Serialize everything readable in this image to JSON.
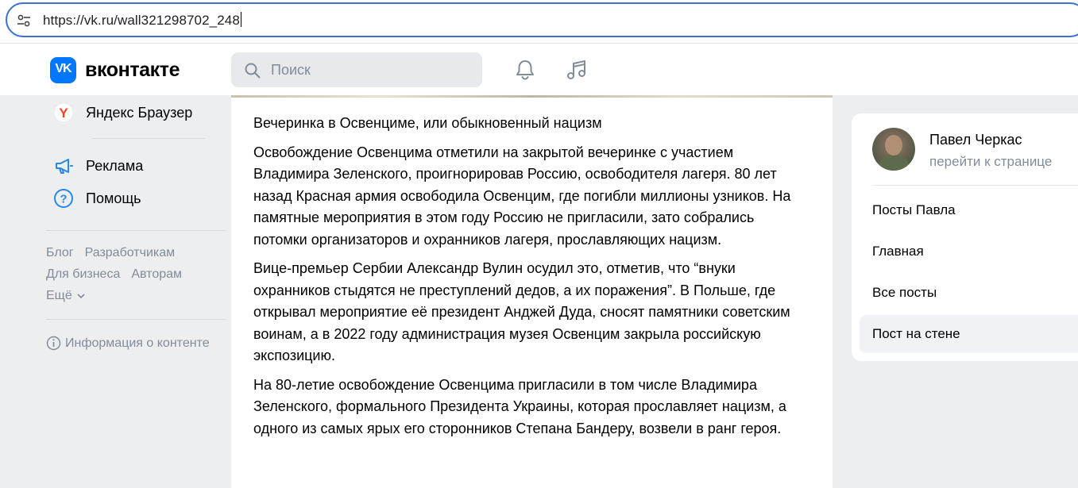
{
  "browser": {
    "url": "https://vk.ru/wall321298702_248"
  },
  "header": {
    "logo_text": "вконтакте",
    "logo_mark": "VK",
    "search_placeholder": "Поиск",
    "icons": [
      "bell-icon",
      "music-icon"
    ]
  },
  "sidebar": {
    "items": [
      {
        "label": "Яндекс Браузер",
        "icon": "yandex-browser-icon"
      },
      {
        "label": "Реклама",
        "icon": "megaphone-icon"
      },
      {
        "label": "Помощь",
        "icon": "help-icon"
      }
    ],
    "footer_links": [
      "Блог",
      "Разработчикам",
      "Для бизнеса",
      "Авторам",
      "Ещё"
    ],
    "content_info": "Информация о контенте"
  },
  "post": {
    "title": "Вечеринка в Освенциме, или обыкновенный нацизм",
    "paragraphs": [
      "Освобождение Освенцима отметили на закрытой вечеринке с участием Владимира Зеленского, проигнорировав Россию, освободителя лагеря. 80 лет назад Красная армия освободила Освенцим, где погибли миллионы узников. На памятные мероприятия в этом году Россию не пригласили, зато собрались потомки организаторов и охранников лагеря, прославляющих нацизм.",
      "Вице-премьер Сербии Александр Вулин осудил это, отметив, что “внуки охранников стыдятся не преступлений дедов, а их поражения”. В Польше, где открывал мероприятие её президент Анджей Дуда, сносят памятники советским воинам, а в 2022 году администрация музея Освенцим закрыла российскую экспозицию.",
      "На 80-летие освобождение Освенцима пригласили в том числе Владимира Зеленского, формального Президента Украины, которая прославляет нацизм, а одного из самых ярых его сторонников Степана Бандеру, возвели в ранг героя."
    ]
  },
  "profile": {
    "name": "Павел Черкас",
    "link": "перейти к странице",
    "menu": [
      "Посты Павла",
      "Главная",
      "Все посты",
      "Пост на стене"
    ],
    "active_index": 3
  },
  "colors": {
    "accent": "#0077ff",
    "muted": "#818c99",
    "background": "#edeef0"
  }
}
